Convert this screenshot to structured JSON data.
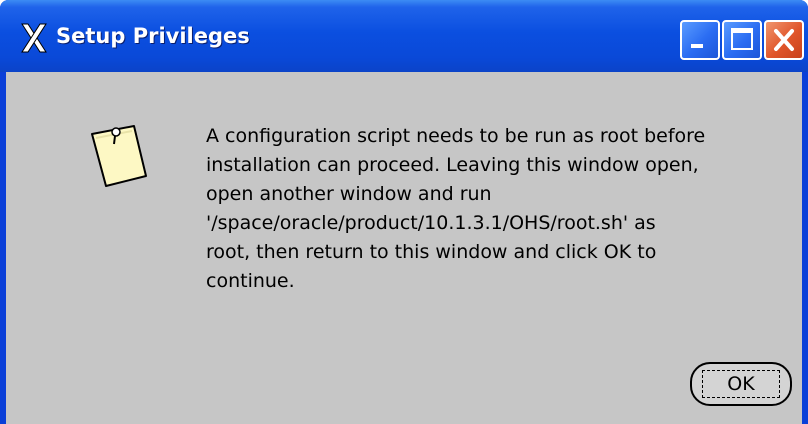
{
  "window": {
    "title": "Setup Privileges",
    "title_icon": "x11-icon",
    "controls": {
      "minimize_icon": "minimize-icon",
      "maximize_icon": "maximize-icon",
      "close_icon": "close-icon"
    }
  },
  "dialog": {
    "icon": "note-icon",
    "message": "A configuration script needs to be run as root before\ninstallation can proceed. Leaving this window open,\nopen another window and run\n'/space/oracle/product/10.1.3.1/OHS/root.sh' as\nroot, then return to this window and click OK to\ncontinue.",
    "ok_label": "OK"
  },
  "colors": {
    "titlebar": "#0a49d8",
    "client_background": "#c6c6c6",
    "close_button": "#e0552a",
    "note_fill": "#fdf8c4"
  }
}
